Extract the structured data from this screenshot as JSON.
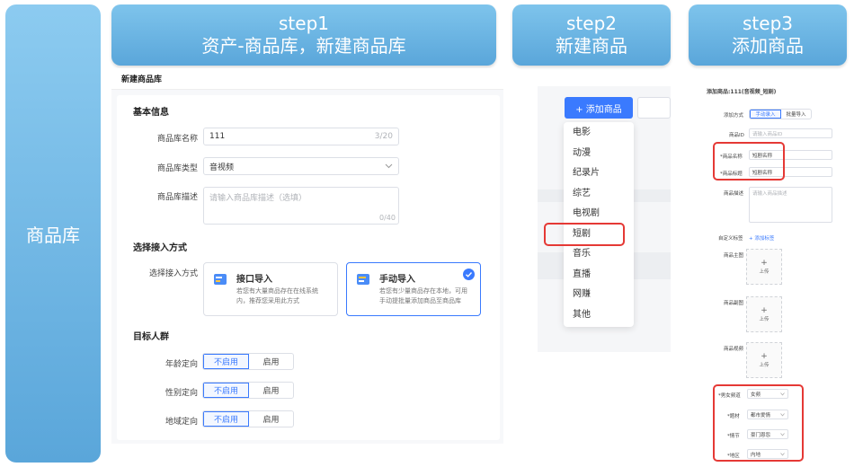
{
  "side_label": "商品库",
  "headers": {
    "step1": {
      "line1": "step1",
      "line2": "资产-商品库，新建商品库"
    },
    "step2": {
      "line1": "step2",
      "line2": "新建商品"
    },
    "step3": {
      "line1": "step3",
      "line2": "添加商品"
    }
  },
  "step1": {
    "page_title": "新建商品库",
    "basic_info_title": "基本信息",
    "name_label": "商品库名称",
    "name_value": "111",
    "name_count": "3/20",
    "type_label": "商品库类型",
    "type_value": "音视频",
    "desc_label": "商品库描述",
    "desc_placeholder": "请输入商品库描述（选填）",
    "desc_count": "0/40",
    "access_title": "选择接入方式",
    "access_label": "选择接入方式",
    "option_api": {
      "title": "接口导入",
      "desc_line1": "若您有大量商品存在在线系统",
      "desc_line2": "内，推荐您采用此方式"
    },
    "option_manual": {
      "title": "手动导入",
      "desc_line1": "若您有少量商品存在本地，可用",
      "desc_line2": "手动提批量添加商品至商品库"
    },
    "audience_title": "目标人群",
    "rows": [
      {
        "label": "年龄定向",
        "off": "不启用",
        "on": "启用"
      },
      {
        "label": "性别定向",
        "off": "不启用",
        "on": "启用"
      },
      {
        "label": "地域定向",
        "off": "不启用",
        "on": "启用"
      }
    ]
  },
  "step2": {
    "add_button": "+ 添加商品",
    "menu": [
      "电影",
      "动漫",
      "纪录片",
      "综艺",
      "电视剧",
      "短剧",
      "音乐",
      "直播",
      "网赚",
      "其他"
    ],
    "highlighted": "短剧"
  },
  "step3": {
    "title": "添加商品:111(音视频_短剧)",
    "method_label": "添加方式",
    "method_manual": "手动录入",
    "method_batch": "批量导入",
    "id_label": "商品ID",
    "id_placeholder": "请输入商品ID",
    "name_label": "*商品名称",
    "name_value": "短剧名称",
    "title_label": "*商品标题",
    "title_value": "短剧名称",
    "desc_label": "商品描述",
    "desc_placeholder": "请输入商品描述",
    "custom_label": "自定义标签",
    "custom_add": "+ 添加标签",
    "main_img_label": "商品主图",
    "sub_img_label": "商品副图",
    "video_label": "商品视频",
    "upload_plus": "+",
    "upload_text": "上传",
    "fields": [
      {
        "label": "*男女频道",
        "value": "女频"
      },
      {
        "label": "*题材",
        "value": "都市爱情"
      },
      {
        "label": "*情节",
        "value": "豪门恩怨"
      },
      {
        "label": "*地区",
        "value": "内地"
      }
    ]
  }
}
